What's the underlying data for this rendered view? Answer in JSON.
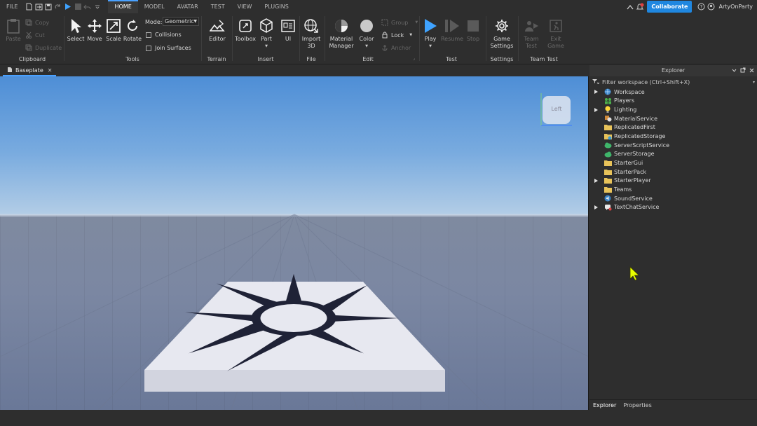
{
  "menu": {
    "file": "FILE",
    "tabs": [
      "HOME",
      "MODEL",
      "AVATAR",
      "TEST",
      "VIEW",
      "PLUGINS"
    ],
    "active_tab": "HOME",
    "collaborate": "Collaborate",
    "username": "ArtyOnParty"
  },
  "ribbon": {
    "clipboard": {
      "label": "Clipboard",
      "paste": "Paste",
      "copy": "Copy",
      "cut": "Cut",
      "duplicate": "Duplicate"
    },
    "tools": {
      "label": "Tools",
      "select": "Select",
      "move": "Move",
      "scale": "Scale",
      "rotate": "Rotate",
      "mode_label": "Mode:",
      "mode_value": "Geometric",
      "collisions": "Collisions",
      "join_surfaces": "Join Surfaces"
    },
    "terrain": {
      "label": "Terrain",
      "editor": "Editor"
    },
    "insert": {
      "label": "Insert",
      "toolbox": "Toolbox",
      "part": "Part",
      "ui": "UI"
    },
    "file": {
      "label": "File",
      "import_line1": "Import",
      "import_line2": "3D"
    },
    "edit": {
      "label": "Edit",
      "material_line1": "Material",
      "material_line2": "Manager",
      "color": "Color",
      "group": "Group",
      "lock": "Lock",
      "anchor": "Anchor"
    },
    "test": {
      "label": "Test",
      "play": "Play",
      "resume": "Resume",
      "stop": "Stop"
    },
    "settings": {
      "label": "Settings",
      "game_line1": "Game",
      "game_line2": "Settings"
    },
    "team_test": {
      "label": "Team Test",
      "team_line1": "Team",
      "team_line2": "Test",
      "exit_line1": "Exit",
      "exit_line2": "Game"
    }
  },
  "document": {
    "tab_title": "Baseplate"
  },
  "viewport": {
    "viewcube_face": "Left"
  },
  "explorer": {
    "title": "Explorer",
    "filter_placeholder": "Filter workspace (Ctrl+Shift+X)",
    "items": [
      {
        "label": "Workspace",
        "icon": "workspace-icon",
        "expandable": true
      },
      {
        "label": "Players",
        "icon": "players-icon",
        "expandable": false
      },
      {
        "label": "Lighting",
        "icon": "lighting-icon",
        "expandable": true
      },
      {
        "label": "MaterialService",
        "icon": "material-service-icon",
        "expandable": false
      },
      {
        "label": "ReplicatedFirst",
        "icon": "folder-icon",
        "expandable": false
      },
      {
        "label": "ReplicatedStorage",
        "icon": "storage-icon",
        "expandable": false
      },
      {
        "label": "ServerScriptService",
        "icon": "server-script-icon",
        "expandable": false
      },
      {
        "label": "ServerStorage",
        "icon": "server-storage-icon",
        "expandable": false
      },
      {
        "label": "StarterGui",
        "icon": "folder-icon",
        "expandable": false
      },
      {
        "label": "StarterPack",
        "icon": "folder-icon",
        "expandable": false
      },
      {
        "label": "StarterPlayer",
        "icon": "folder-icon",
        "expandable": true
      },
      {
        "label": "Teams",
        "icon": "folder-icon",
        "expandable": false
      },
      {
        "label": "SoundService",
        "icon": "sound-icon",
        "expandable": false
      },
      {
        "label": "TextChatService",
        "icon": "chat-icon",
        "expandable": true
      }
    ],
    "bottom_tabs": [
      "Explorer",
      "Properties"
    ]
  },
  "colors": {
    "accent": "#4aa1ff",
    "collaborate": "#1f87e0",
    "panel": "#2e2e2e",
    "cursor": "#e8ff00"
  }
}
